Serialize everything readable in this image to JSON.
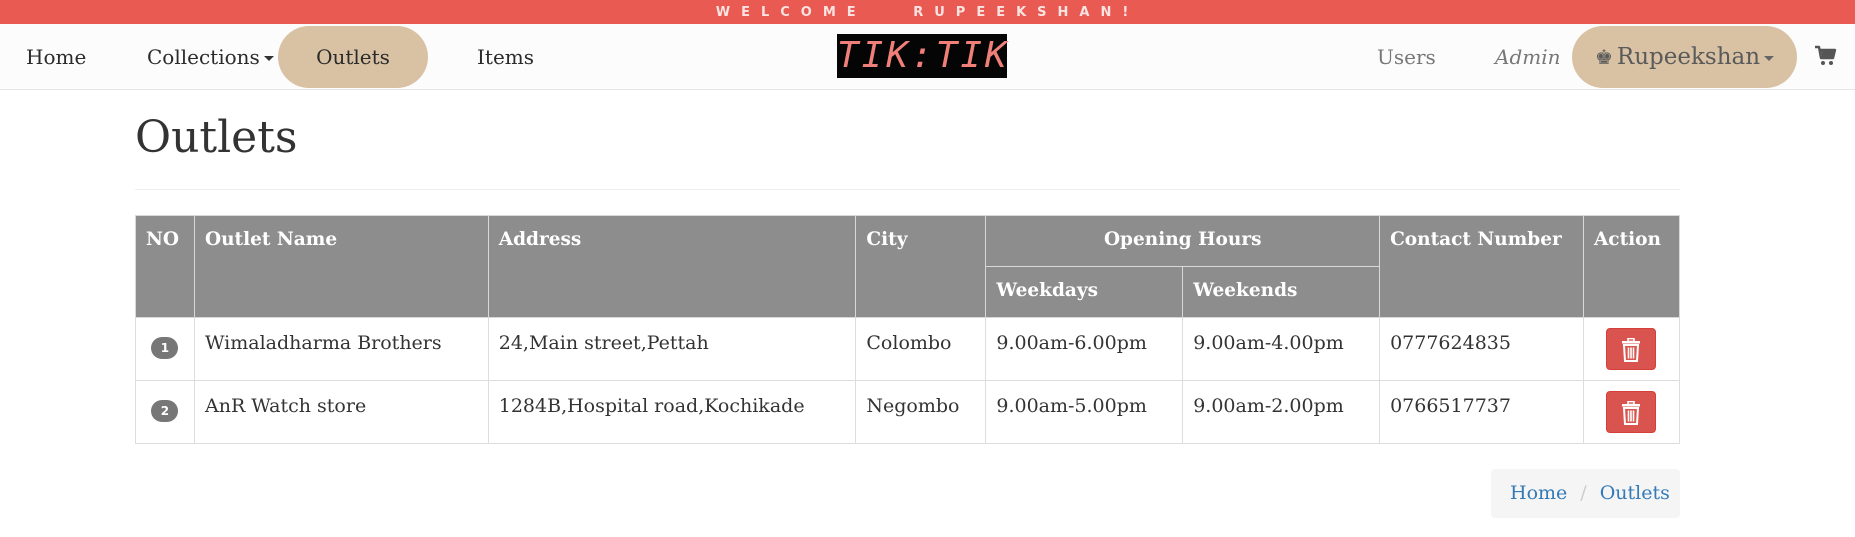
{
  "welcome": "WELCOME   RUPEEKSHAN!",
  "nav": {
    "home": "Home",
    "collections": "Collections",
    "outlets": "Outlets",
    "items": "Items",
    "logo": "TIK:TIK",
    "users": "Users",
    "admin": "Admin",
    "user_name": "Rupeekshan",
    "cart_icon": "shopping-cart-icon"
  },
  "page": {
    "title": "Outlets"
  },
  "table": {
    "headers": {
      "no": "NO",
      "outlet_name": "Outlet Name",
      "address": "Address",
      "city": "City",
      "opening_hours": "Opening Hours",
      "weekdays": "Weekdays",
      "weekends": "Weekends",
      "contact": "Contact Number",
      "action": "Action"
    },
    "rows": [
      {
        "no": "1",
        "name": "Wimaladharma Brothers",
        "address": "24,Main street,Pettah",
        "city": "Colombo",
        "weekdays": "9.00am-6.00pm",
        "weekends": "9.00am-4.00pm",
        "contact": "0777624835"
      },
      {
        "no": "2",
        "name": "AnR Watch store",
        "address": "1284B,Hospital road,Kochikade",
        "city": "Negombo",
        "weekdays": "9.00am-5.00pm",
        "weekends": "9.00am-2.00pm",
        "contact": "0766517737"
      }
    ]
  },
  "breadcrumb": {
    "home": "Home",
    "current": "Outlets"
  },
  "colors": {
    "welcome_bar": "#e85a52",
    "nav_pill": "#d9c2a3",
    "table_header": "#8d8d8d",
    "delete_button": "#d9534f",
    "link": "#337ab7"
  }
}
